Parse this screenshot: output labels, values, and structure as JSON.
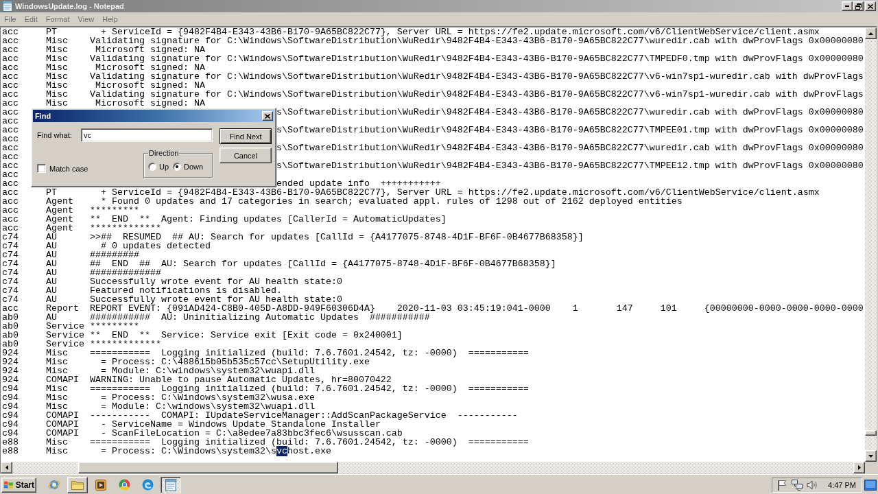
{
  "window": {
    "title": "WindowsUpdate.log - Notepad"
  },
  "menu": [
    "File",
    "Edit",
    "Format",
    "View",
    "Help"
  ],
  "editor": {
    "lines": [
      {
        "kind": "plain",
        "text": "acc     PT        + ServiceId = {9482F4B4-E343-43B6-B170-9A65BC822C77}, Server URL = https://fe2.update.microsoft.com/v6/ClientWebService/client.asmx"
      },
      {
        "kind": "plain",
        "text": "acc     Misc    Validating signature for C:\\Windows\\SoftwareDistribution\\WuRedir\\9482F4B4-E343-43B6-B170-9A65BC822C77\\wuredir.cab with dwProvFlags 0x00000080"
      },
      {
        "kind": "plain",
        "text": "acc     Misc     Microsoft signed: NA"
      },
      {
        "kind": "plain",
        "text": "acc     Misc    Validating signature for C:\\Windows\\SoftwareDistribution\\WuRedir\\9482F4B4-E343-43B6-B170-9A65BC822C77\\TMPEDF0.tmp with dwProvFlags 0x00000080"
      },
      {
        "kind": "plain",
        "text": "acc     Misc     Microsoft signed: NA"
      },
      {
        "kind": "plain",
        "text": "acc     Misc    Validating signature for C:\\Windows\\SoftwareDistribution\\WuRedir\\9482F4B4-E343-43B6-B170-9A65BC822C77\\v6-win7sp1-wuredir.cab with dwProvFlags"
      },
      {
        "kind": "plain",
        "text": "acc     Misc     Microsoft signed: NA"
      },
      {
        "kind": "plain",
        "text": "acc     Misc    Validating signature for C:\\Windows\\SoftwareDistribution\\WuRedir\\9482F4B4-E343-43B6-B170-9A65BC822C77\\v6-win7sp1-wuredir.cab with dwProvFlags"
      },
      {
        "kind": "plain",
        "text": "acc     Misc     Microsoft signed: NA"
      },
      {
        "kind": "covered",
        "text": "acc",
        "tail": "s\\SoftwareDistribution\\WuRedir\\9482F4B4-E343-43B6-B170-9A65BC822C77\\wuredir.cab with dwProvFlags 0x00000080"
      },
      {
        "kind": "covered",
        "text": "acc"
      },
      {
        "kind": "covered",
        "text": "acc",
        "tail": "s\\SoftwareDistribution\\WuRedir\\9482F4B4-E343-43B6-B170-9A65BC822C77\\TMPEE01.tmp with dwProvFlags 0x00000080"
      },
      {
        "kind": "covered",
        "text": "acc"
      },
      {
        "kind": "covered",
        "text": "acc",
        "tail": "s\\SoftwareDistribution\\WuRedir\\9482F4B4-E343-43B6-B170-9A65BC822C77\\wuredir.cab with dwProvFlags 0x00000080"
      },
      {
        "kind": "covered",
        "text": "acc"
      },
      {
        "kind": "covered",
        "text": "acc",
        "tail": "s\\SoftwareDistribution\\WuRedir\\9482F4B4-E343-43B6-B170-9A65BC822C77\\TMPEE12.tmp with dwProvFlags 0x00000080"
      },
      {
        "kind": "covered",
        "text": "acc"
      },
      {
        "kind": "covered",
        "text": "acc",
        "tail": "ended update info  +++++++++++"
      },
      {
        "kind": "plain",
        "text": "acc     PT        + ServiceId = {9482F4B4-E343-43B6-B170-9A65BC822C77}, Server URL = https://fe2.update.microsoft.com/v6/ClientWebService/client.asmx"
      },
      {
        "kind": "plain",
        "text": "acc     Agent     * Found 0 updates and 17 categories in search; evaluated appl. rules of 1298 out of 2162 deployed entities"
      },
      {
        "kind": "plain",
        "text": "acc     Agent   *********"
      },
      {
        "kind": "plain",
        "text": "acc     Agent   **  END  **  Agent: Finding updates [CallerId = AutomaticUpdates]"
      },
      {
        "kind": "plain",
        "text": "acc     Agent   *************"
      },
      {
        "kind": "plain",
        "text": "c74     AU      >>##  RESUMED  ## AU: Search for updates [CallId = {A4177075-8748-4D1F-BF6F-0B4677B68358}]"
      },
      {
        "kind": "plain",
        "text": "c74     AU        # 0 updates detected"
      },
      {
        "kind": "plain",
        "text": "c74     AU      #########"
      },
      {
        "kind": "plain",
        "text": "c74     AU      ##  END  ##  AU: Search for updates [CallId = {A4177075-8748-4D1F-BF6F-0B4677B68358}]"
      },
      {
        "kind": "plain",
        "text": "c74     AU      #############"
      },
      {
        "kind": "plain",
        "text": "c74     AU      Successfully wrote event for AU health state:0"
      },
      {
        "kind": "plain",
        "text": "c74     AU      Featured notifications is disabled."
      },
      {
        "kind": "plain",
        "text": "c74     AU      Successfully wrote event for AU health state:0"
      },
      {
        "kind": "plain",
        "text": "acc     Report  REPORT EVENT: {091AD424-C8B0-405D-A8DD-949F60306D4A}    2020-11-03 03:45:19:041-0000    1       147     101     {00000000-0000-0000-0000-0000"
      },
      {
        "kind": "plain",
        "text": "ab0     AU      ###########  AU: Uninitializing Automatic Updates  ###########"
      },
      {
        "kind": "plain",
        "text": "ab0     Service *********"
      },
      {
        "kind": "plain",
        "text": "ab0     Service **  END  **  Service: Service exit [Exit code = 0x240001]"
      },
      {
        "kind": "plain",
        "text": "ab0     Service *************"
      },
      {
        "kind": "plain",
        "text": "924     Misc    ===========  Logging initialized (build: 7.6.7601.24542, tz: -0000)  ==========="
      },
      {
        "kind": "plain",
        "text": "924     Misc      = Process: C:\\488615b05b535c57cc\\SetupUtility.exe"
      },
      {
        "kind": "plain",
        "text": "924     Misc      = Module: C:\\windows\\system32\\wuapi.dll"
      },
      {
        "kind": "plain",
        "text": "924     COMAPI  WARNING: Unable to pause Automatic Updates, hr=80070422"
      },
      {
        "kind": "plain",
        "text": "c94     Misc    ===========  Logging initialized (build: 7.6.7601.24542, tz: -0000)  ==========="
      },
      {
        "kind": "plain",
        "text": "c94     Misc      = Process: C:\\Windows\\system32\\wusa.exe"
      },
      {
        "kind": "plain",
        "text": "c94     Misc      = Module: C:\\windows\\system32\\wuapi.dll"
      },
      {
        "kind": "plain",
        "text": "c94     COMAPI  -----------  COMAPI: IUpdateServiceManager::AddScanPackageService  -----------"
      },
      {
        "kind": "plain",
        "text": "c94     COMAPI    - ServiceName = Windows Update Standalone Installer"
      },
      {
        "kind": "plain",
        "text": "c94     COMAPI    - ScanFileLocation = C:\\a8edee7a83bbc3fec6\\wsusscan.cab"
      },
      {
        "kind": "plain",
        "text": "e88     Misc    ===========  Logging initialized (build: 7.6.7601.24542, tz: -0000)  ==========="
      },
      {
        "kind": "match",
        "text": "e88     Misc      = Process: C:\\Windows\\system32\\s",
        "match": "vc",
        "tail": "host.exe"
      }
    ]
  },
  "find_dialog": {
    "title": "Find",
    "find_what": {
      "label": "Find what:",
      "value": "vc"
    },
    "buttons": [
      {
        "label": "Find Next",
        "default": true
      },
      {
        "label": "Cancel",
        "default": false
      }
    ],
    "direction": {
      "label": "Direction",
      "options": [
        {
          "label": "Up",
          "selected": false
        },
        {
          "label": "Down",
          "selected": true
        }
      ]
    },
    "match_case": {
      "label": "Match case",
      "checked": false
    }
  },
  "taskbar": {
    "start": "Start",
    "apps": [
      {
        "kind": "globe",
        "running": false,
        "selected": false
      },
      {
        "kind": "folder",
        "running": true,
        "selected": false
      },
      {
        "kind": "player",
        "running": false,
        "selected": false
      },
      {
        "kind": "ring",
        "running": false,
        "selected": false
      },
      {
        "kind": "swirl",
        "running": false,
        "selected": false
      },
      {
        "kind": "notepad",
        "running": true,
        "selected": true
      }
    ],
    "clock": "4:47 PM"
  }
}
